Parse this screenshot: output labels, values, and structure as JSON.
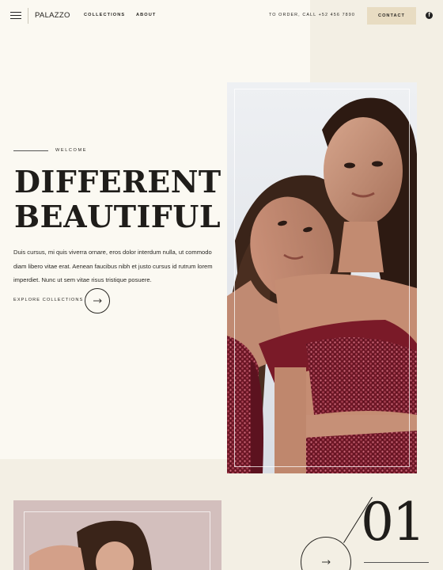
{
  "header": {
    "logo": "PALAZZO",
    "nav": [
      {
        "label": "COLLECTIONS"
      },
      {
        "label": "ABOUT"
      }
    ],
    "order_text": "TO ORDER, CALL +52 456 7890",
    "contact_label": "CONTACT",
    "icons": {
      "menu": "hamburger-menu-icon",
      "social": "facebook-icon"
    }
  },
  "hero": {
    "eyebrow": "WELCOME",
    "headline": [
      "DIFFERENT IS",
      "BEAUTIFUL"
    ],
    "intro": "Duis cursus, mi quis viverra ornare, eros dolor interdum nulla, ut commodo diam libero vitae erat. Aenean faucibus nibh et justo cursus id rutrum lorem imperdiet. Nunc ut sem vitae risus tristique posuere.",
    "cta_label": "EXPLORE COLLECTIONS"
  },
  "collection": {
    "number": "01"
  },
  "colors": {
    "background": "#f3efe4",
    "panel": "#fbf9f2",
    "accent": "#e8dcc2",
    "text": "#1f1d1a",
    "dress": "#7a1a28"
  }
}
